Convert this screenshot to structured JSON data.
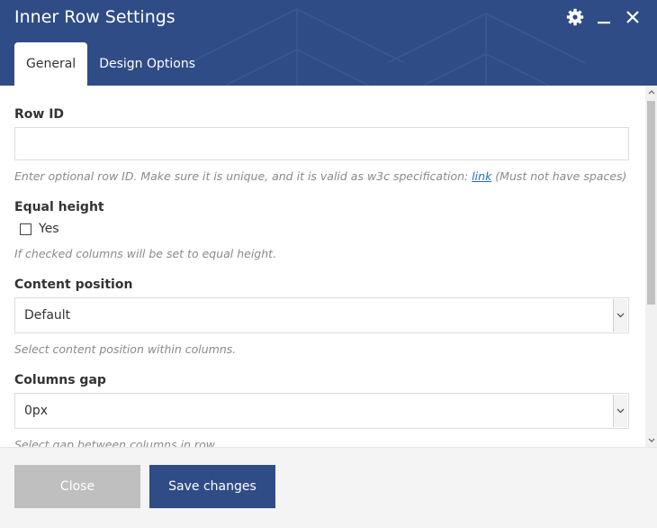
{
  "dialog": {
    "title": "Inner Row Settings",
    "tabs": [
      {
        "label": "General",
        "active": true
      },
      {
        "label": "Design Options",
        "active": false
      }
    ]
  },
  "fields": {
    "row_id": {
      "label": "Row ID",
      "value": "",
      "help_before": "Enter optional row ID. Make sure it is unique, and it is valid as w3c specification: ",
      "help_link": "link",
      "help_after": " (Must not have spaces)"
    },
    "equal_height": {
      "label": "Equal height",
      "option_label": "Yes",
      "checked": false,
      "help": "If checked columns will be set to equal height."
    },
    "content_position": {
      "label": "Content position",
      "selected": "Default",
      "help": "Select content position within columns."
    },
    "columns_gap": {
      "label": "Columns gap",
      "selected": "0px",
      "help": "Select gap between columns in row."
    }
  },
  "footer": {
    "close_label": "Close",
    "save_label": "Save changes"
  },
  "colors": {
    "header": "#2f4c86",
    "save_button": "#2f4c86",
    "close_button": "#bfbfbf",
    "link": "#1f6fb6"
  },
  "icons": [
    "gear-icon",
    "minimize-icon",
    "close-icon",
    "chevron-down-icon"
  ]
}
